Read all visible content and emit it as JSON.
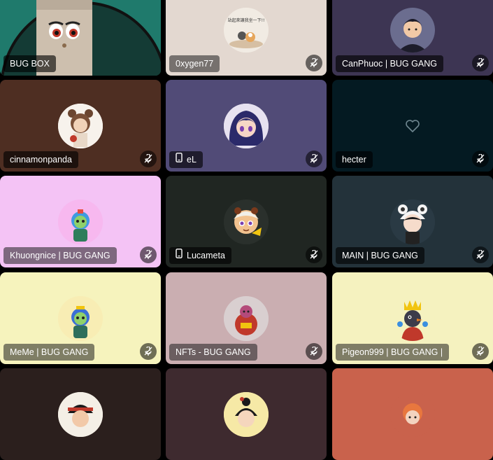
{
  "participants": [
    {
      "name": "BUG BOX",
      "bg": "#1f7a6c",
      "mobile": false,
      "muted": false,
      "speaking": true
    },
    {
      "name": "0xygen77",
      "bg": "#e3d8d0",
      "mobile": false,
      "muted": true,
      "avatar_text": "站起來讓我坐一下!!"
    },
    {
      "name": "CanPhuoc | BUG GANG",
      "bg": "#3d3553",
      "mobile": false,
      "muted": true
    },
    {
      "name": "cinnamonpanda",
      "bg": "#4e2e22",
      "mobile": false,
      "muted": true
    },
    {
      "name": "eL",
      "bg": "#514b77",
      "mobile": true,
      "muted": true
    },
    {
      "name": "hecter",
      "bg": "#041a22",
      "mobile": false,
      "muted": true
    },
    {
      "name": "Khuongnice | BUG GANG",
      "bg": "#f4c3f5",
      "mobile": false,
      "muted": true
    },
    {
      "name": "Lucameta",
      "bg": "#202622",
      "mobile": true,
      "muted": true
    },
    {
      "name": "MAIN | BUG GANG",
      "bg": "#23323a",
      "mobile": false,
      "muted": true
    },
    {
      "name": "MeMe | BUG GANG",
      "bg": "#f6f3bd",
      "mobile": false,
      "muted": true
    },
    {
      "name": "NFTs - BUG GANG",
      "bg": "#caaeb1",
      "mobile": false,
      "muted": true
    },
    {
      "name": "Pigeon999 | BUG GANG |",
      "bg": "#f5f2bf",
      "mobile": false,
      "muted": true
    },
    {
      "name": "",
      "bg": "#2b1f1d",
      "mobile": false,
      "muted": false
    },
    {
      "name": "",
      "bg": "#3e2a2f",
      "mobile": false,
      "muted": false
    },
    {
      "name": "",
      "bg": "#c9624c",
      "mobile": false,
      "muted": false
    }
  ],
  "icons": {
    "mute": "mic-muted-icon",
    "mobile": "mobile-phone-icon",
    "no_avatar": "heart-icon"
  }
}
